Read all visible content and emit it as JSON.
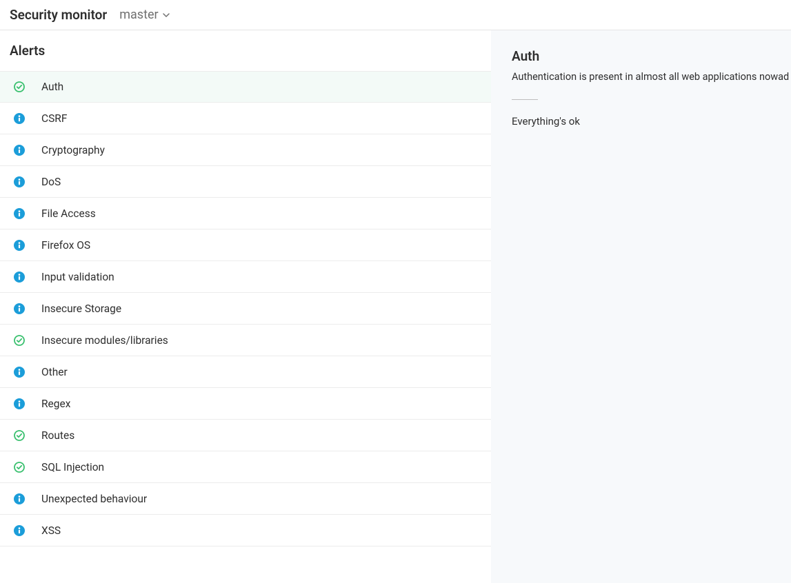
{
  "header": {
    "title": "Security monitor",
    "branch": "master"
  },
  "alerts": {
    "heading": "Alerts",
    "items": [
      {
        "label": "Auth",
        "status": "ok",
        "selected": true
      },
      {
        "label": "CSRF",
        "status": "info",
        "selected": false
      },
      {
        "label": "Cryptography",
        "status": "info",
        "selected": false
      },
      {
        "label": "DoS",
        "status": "info",
        "selected": false
      },
      {
        "label": "File Access",
        "status": "info",
        "selected": false
      },
      {
        "label": "Firefox OS",
        "status": "info",
        "selected": false
      },
      {
        "label": "Input validation",
        "status": "info",
        "selected": false
      },
      {
        "label": "Insecure Storage",
        "status": "info",
        "selected": false
      },
      {
        "label": "Insecure modules/libraries",
        "status": "ok",
        "selected": false
      },
      {
        "label": "Other",
        "status": "info",
        "selected": false
      },
      {
        "label": "Regex",
        "status": "info",
        "selected": false
      },
      {
        "label": "Routes",
        "status": "ok",
        "selected": false
      },
      {
        "label": "SQL Injection",
        "status": "ok",
        "selected": false
      },
      {
        "label": "Unexpected behaviour",
        "status": "info",
        "selected": false
      },
      {
        "label": "XSS",
        "status": "info",
        "selected": false
      }
    ]
  },
  "detail": {
    "title": "Auth",
    "description": "Authentication is present in almost all web applications nowad",
    "status_text": "Everything's ok"
  },
  "colors": {
    "ok": "#3ac06f",
    "info": "#1b9dd9"
  }
}
